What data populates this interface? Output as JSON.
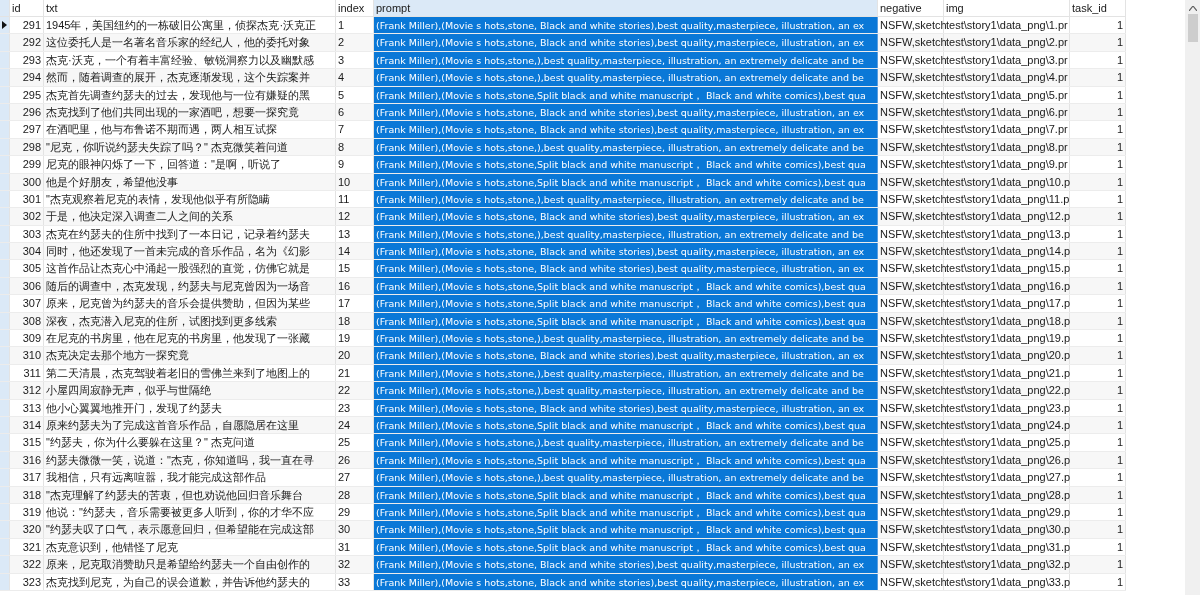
{
  "columns": [
    {
      "label": "id",
      "kind": "number",
      "selected": false
    },
    {
      "label": "txt",
      "kind": "text",
      "selected": false
    },
    {
      "label": "index",
      "kind": "text",
      "selected": false
    },
    {
      "label": "prompt",
      "kind": "text",
      "selected": true
    },
    {
      "label": "negative",
      "kind": "text",
      "selected": false
    },
    {
      "label": "img",
      "kind": "text",
      "selected": false
    },
    {
      "label": "task_id",
      "kind": "number",
      "selected": false
    }
  ],
  "rows": [
    {
      "current": true,
      "cells": [
        "291",
        "1945年，美国纽约的一栋破旧公寓里，侦探杰克·沃克正",
        "1",
        "(Frank Miller),(Movie s hots,stone, Black and white stories),best quality,masterpiece, illustration, an ex",
        "NSFW,sketch",
        "test\\story1\\data_png\\1.pr",
        "1"
      ]
    },
    {
      "current": false,
      "cells": [
        "292",
        "这位委托人是一名著名音乐家的经纪人，他的委托对象",
        "2",
        "(Frank Miller),(Movie s hots,stone, Black and white stories),best quality,masterpiece, illustration, an ex",
        "NSFW,sketch",
        "test\\story1\\data_png\\2.pr",
        "1"
      ]
    },
    {
      "current": false,
      "cells": [
        "293",
        "杰克·沃克，一个有着丰富经验、敏锐洞察力以及幽默感",
        "3",
        "(Frank Miller),(Movie s hots,stone,),best quality,masterpiece, illustration, an extremely delicate and be",
        "NSFW,sketch",
        "test\\story1\\data_png\\3.pr",
        "1"
      ]
    },
    {
      "current": false,
      "cells": [
        "294",
        "然而，随着调查的展开，杰克逐渐发现，这个失踪案并",
        "4",
        "(Frank Miller),(Movie s hots,stone,),best quality,masterpiece, illustration, an extremely delicate and be",
        "NSFW,sketch",
        "test\\story1\\data_png\\4.pr",
        "1"
      ]
    },
    {
      "current": false,
      "cells": [
        "295",
        "杰克首先调查约瑟夫的过去，发现他与一位有嫌疑的黑",
        "5",
        "(Frank Miller),(Movie s hots,stone,Split black and white manuscript， Black and white comics),best qua",
        "NSFW,sketch",
        "test\\story1\\data_png\\5.pr",
        "1"
      ]
    },
    {
      "current": false,
      "cells": [
        "296",
        "杰克找到了他们共同出现的一家酒吧，想要一探究竟",
        "6",
        "(Frank Miller),(Movie s hots,stone, Black and white stories),best quality,masterpiece, illustration, an ex",
        "NSFW,sketch",
        "test\\story1\\data_png\\6.pr",
        "1"
      ]
    },
    {
      "current": false,
      "cells": [
        "297",
        "在酒吧里，他与布鲁诺不期而遇，两人相互试探",
        "7",
        "(Frank Miller),(Movie s hots,stone, Black and white stories),best quality,masterpiece, illustration, an ex",
        "NSFW,sketch",
        "test\\story1\\data_png\\7.pr",
        "1"
      ]
    },
    {
      "current": false,
      "cells": [
        "298",
        "\"尼克，你听说约瑟夫失踪了吗？\" 杰克微笑着问道",
        "8",
        "(Frank Miller),(Movie s hots,stone,),best quality,masterpiece, illustration, an extremely delicate and be",
        "NSFW,sketch",
        "test\\story1\\data_png\\8.pr",
        "1"
      ]
    },
    {
      "current": false,
      "cells": [
        "299",
        "尼克的眼神闪烁了一下，回答道：\"是啊，听说了",
        "9",
        "(Frank Miller),(Movie s hots,stone,Split black and white manuscript， Black and white comics),best qua",
        "NSFW,sketch",
        "test\\story1\\data_png\\9.pr",
        "1"
      ]
    },
    {
      "current": false,
      "cells": [
        "300",
        "他是个好朋友，希望他没事",
        "10",
        "(Frank Miller),(Movie s hots,stone,Split black and white manuscript， Black and white comics),best qua",
        "NSFW,sketch",
        "test\\story1\\data_png\\10.p",
        "1"
      ]
    },
    {
      "current": false,
      "cells": [
        "301",
        "\"杰克观察着尼克的表情，发现他似乎有所隐瞒",
        "11",
        "(Frank Miller),(Movie s hots,stone,),best quality,masterpiece, illustration, an extremely delicate and be",
        "NSFW,sketch",
        "test\\story1\\data_png\\11.p",
        "1"
      ]
    },
    {
      "current": false,
      "cells": [
        "302",
        "于是，他决定深入调查二人之间的关系",
        "12",
        "(Frank Miller),(Movie s hots,stone, Black and white stories),best quality,masterpiece, illustration, an ex",
        "NSFW,sketch",
        "test\\story1\\data_png\\12.p",
        "1"
      ]
    },
    {
      "current": false,
      "cells": [
        "303",
        "杰克在约瑟夫的住所中找到了一本日记，记录着约瑟夫",
        "13",
        "(Frank Miller),(Movie s hots,stone,),best quality,masterpiece, illustration, an extremely delicate and be",
        "NSFW,sketch",
        "test\\story1\\data_png\\13.p",
        "1"
      ]
    },
    {
      "current": false,
      "cells": [
        "304",
        "同时，他还发现了一首未完成的音乐作品，名为《幻影",
        "14",
        "(Frank Miller),(Movie s hots,stone, Black and white stories),best quality,masterpiece, illustration, an ex",
        "NSFW,sketch",
        "test\\story1\\data_png\\14.p",
        "1"
      ]
    },
    {
      "current": false,
      "cells": [
        "305",
        "这首作品让杰克心中涌起一股强烈的直觉，仿佛它就是",
        "15",
        "(Frank Miller),(Movie s hots,stone, Black and white stories),best quality,masterpiece, illustration, an ex",
        "NSFW,sketch",
        "test\\story1\\data_png\\15.p",
        "1"
      ]
    },
    {
      "current": false,
      "cells": [
        "306",
        "随后的调查中，杰克发现，约瑟夫与尼克曾因为一场音",
        "16",
        "(Frank Miller),(Movie s hots,stone,Split black and white manuscript， Black and white comics),best qua",
        "NSFW,sketch",
        "test\\story1\\data_png\\16.p",
        "1"
      ]
    },
    {
      "current": false,
      "cells": [
        "307",
        "原来，尼克曾为约瑟夫的音乐会提供赞助，但因为某些",
        "17",
        "(Frank Miller),(Movie s hots,stone,Split black and white manuscript， Black and white comics),best qua",
        "NSFW,sketch",
        "test\\story1\\data_png\\17.p",
        "1"
      ]
    },
    {
      "current": false,
      "cells": [
        "308",
        "深夜，杰克潜入尼克的住所，试图找到更多线索",
        "18",
        "(Frank Miller),(Movie s hots,stone,Split black and white manuscript， Black and white comics),best qua",
        "NSFW,sketch",
        "test\\story1\\data_png\\18.p",
        "1"
      ]
    },
    {
      "current": false,
      "cells": [
        "309",
        "在尼克的书房里，他在尼克的书房里，他发现了一张藏",
        "19",
        "(Frank Miller),(Movie s hots,stone,),best quality,masterpiece, illustration, an extremely delicate and be",
        "NSFW,sketch",
        "test\\story1\\data_png\\19.p",
        "1"
      ]
    },
    {
      "current": false,
      "cells": [
        "310",
        "杰克决定去那个地方一探究竟",
        "20",
        "(Frank Miller),(Movie s hots,stone, Black and white stories),best quality,masterpiece, illustration, an ex",
        "NSFW,sketch",
        "test\\story1\\data_png\\20.p",
        "1"
      ]
    },
    {
      "current": false,
      "cells": [
        "311",
        "第二天清晨，杰克驾驶着老旧的雪佛兰来到了地图上的",
        "21",
        "(Frank Miller),(Movie s hots,stone,),best quality,masterpiece, illustration, an extremely delicate and be",
        "NSFW,sketch",
        "test\\story1\\data_png\\21.p",
        "1"
      ]
    },
    {
      "current": false,
      "cells": [
        "312",
        "小屋四周寂静无声，似乎与世隔绝",
        "22",
        "(Frank Miller),(Movie s hots,stone,),best quality,masterpiece, illustration, an extremely delicate and be",
        "NSFW,sketch",
        "test\\story1\\data_png\\22.p",
        "1"
      ]
    },
    {
      "current": false,
      "cells": [
        "313",
        "他小心翼翼地推开门，发现了约瑟夫",
        "23",
        "(Frank Miller),(Movie s hots,stone, Black and white stories),best quality,masterpiece, illustration, an ex",
        "NSFW,sketch",
        "test\\story1\\data_png\\23.p",
        "1"
      ]
    },
    {
      "current": false,
      "cells": [
        "314",
        "原来约瑟夫为了完成这首音乐作品，自愿隐居在这里",
        "24",
        "(Frank Miller),(Movie s hots,stone,Split black and white manuscript， Black and white comics),best qua",
        "NSFW,sketch",
        "test\\story1\\data_png\\24.p",
        "1"
      ]
    },
    {
      "current": false,
      "cells": [
        "315",
        "\"约瑟夫，你为什么要躲在这里？\" 杰克问道",
        "25",
        "(Frank Miller),(Movie s hots,stone,),best quality,masterpiece, illustration, an extremely delicate and be",
        "NSFW,sketch",
        "test\\story1\\data_png\\25.p",
        "1"
      ]
    },
    {
      "current": false,
      "cells": [
        "316",
        "约瑟夫微微一笑，说道：\"杰克，你知道吗，我一直在寻",
        "26",
        "(Frank Miller),(Movie s hots,stone,Split black and white manuscript， Black and white comics),best qua",
        "NSFW,sketch",
        "test\\story1\\data_png\\26.p",
        "1"
      ]
    },
    {
      "current": false,
      "cells": [
        "317",
        "我相信，只有远离喧嚣，我才能完成这部作品",
        "27",
        "(Frank Miller),(Movie s hots,stone,),best quality,masterpiece, illustration, an extremely delicate and be",
        "NSFW,sketch",
        "test\\story1\\data_png\\27.p",
        "1"
      ]
    },
    {
      "current": false,
      "cells": [
        "318",
        "\"杰克理解了约瑟夫的苦衷，但也劝说他回归音乐舞台",
        "28",
        "(Frank Miller),(Movie s hots,stone,Split black and white manuscript， Black and white comics),best qua",
        "NSFW,sketch",
        "test\\story1\\data_png\\28.p",
        "1"
      ]
    },
    {
      "current": false,
      "cells": [
        "319",
        "他说：\"约瑟夫，音乐需要被更多人听到，你的才华不应",
        "29",
        "(Frank Miller),(Movie s hots,stone,Split black and white manuscript， Black and white comics),best qua",
        "NSFW,sketch",
        "test\\story1\\data_png\\29.p",
        "1"
      ]
    },
    {
      "current": false,
      "cells": [
        "320",
        "\"约瑟夫叹了口气，表示愿意回归，但希望能在完成这部",
        "30",
        "(Frank Miller),(Movie s hots,stone,Split black and white manuscript， Black and white comics),best qua",
        "NSFW,sketch",
        "test\\story1\\data_png\\30.p",
        "1"
      ]
    },
    {
      "current": false,
      "cells": [
        "321",
        "杰克意识到，他错怪了尼克",
        "31",
        "(Frank Miller),(Movie s hots,stone,Split black and white manuscript， Black and white comics),best qua",
        "NSFW,sketch",
        "test\\story1\\data_png\\31.p",
        "1"
      ]
    },
    {
      "current": false,
      "cells": [
        "322",
        "原来，尼克取消赞助只是希望给约瑟夫一个自由创作的",
        "32",
        "(Frank Miller),(Movie s hots,stone, Black and white stories),best quality,masterpiece, illustration, an ex",
        "NSFW,sketch",
        "test\\story1\\data_png\\32.p",
        "1"
      ]
    },
    {
      "current": false,
      "cells": [
        "323",
        "杰克找到尼克，为自己的误会道歉，并告诉他约瑟夫的",
        "33",
        "(Frank Miller),(Movie s hots,stone, Black and white stories),best quality,masterpiece, illustration, an ex",
        "NSFW,sketch",
        "test\\story1\\data_png\\33.p",
        "1"
      ]
    }
  ]
}
